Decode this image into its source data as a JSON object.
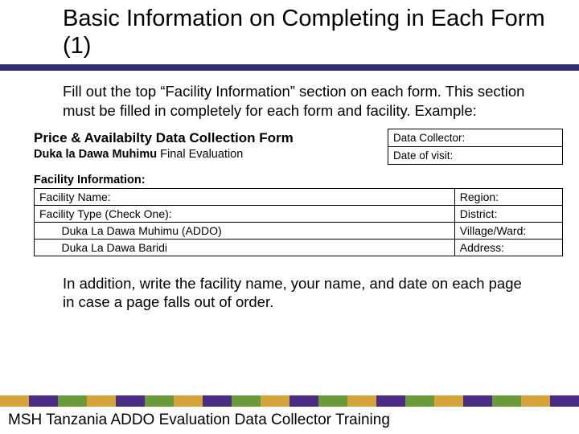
{
  "title": "Basic Information on Completing in Each Form (1)",
  "intro": "Fill out the top “Facility Information” section on each form. This section must be filled in completely for each form and facility. Example:",
  "form": {
    "header": "Price & Availabilty Data Collection Form",
    "subheader_bold": "Duka la Dawa Muhimu",
    "subheader_rest": " Final Evaluation",
    "topbox1": "Data Collector:",
    "topbox2": "Date of visit:",
    "section_label": "Facility Information:",
    "rows": {
      "r1_left": "Facility Name:",
      "r1_right": "Region:",
      "r2_left": "Facility Type (Check One):",
      "r2_right": "District:",
      "r3_left": "Duka La Dawa Muhimu (ADDO)",
      "r3_right": "Village/Ward:",
      "r4_left": "Duka La Dawa Baridi",
      "r4_right": "Address:"
    }
  },
  "outro": "In addition, write the facility name, your name, and date on each page in case a page falls out of order.",
  "footer": "MSH Tanzania ADDO Evaluation Data Collector Training",
  "stripe_colors": [
    "#d4a43a",
    "#4b2e83",
    "#6b9a3d",
    "#d4a43a",
    "#4b2e83",
    "#6b9a3d",
    "#d4a43a",
    "#4b2e83",
    "#6b9a3d",
    "#d4a43a",
    "#4b2e83",
    "#6b9a3d",
    "#d4a43a",
    "#4b2e83",
    "#6b9a3d",
    "#d4a43a",
    "#4b2e83",
    "#6b9a3d",
    "#d4a43a",
    "#4b2e83"
  ]
}
